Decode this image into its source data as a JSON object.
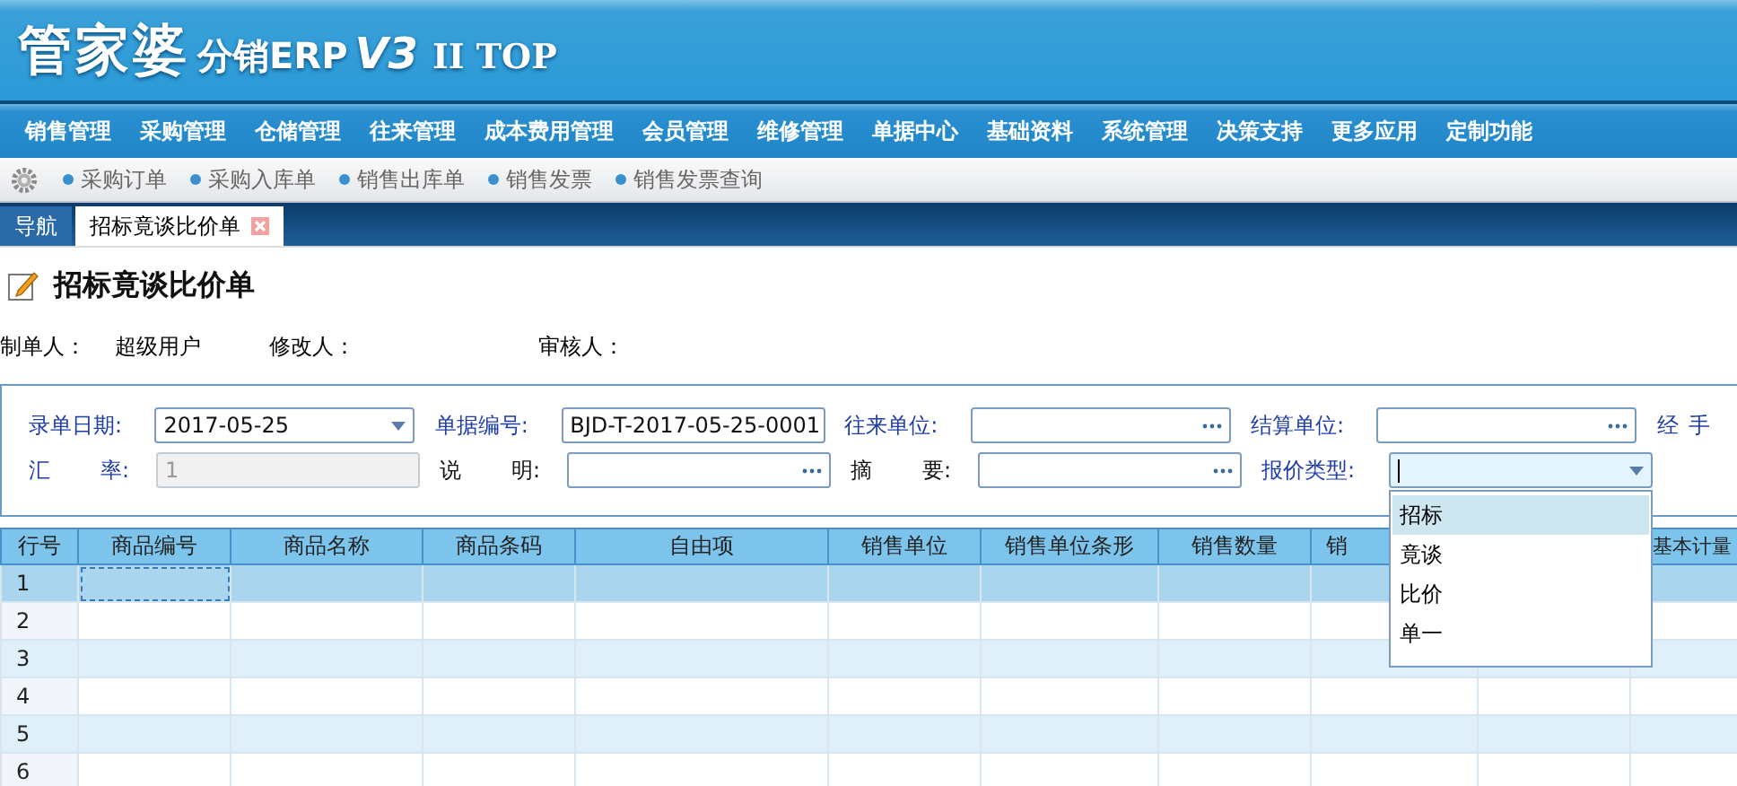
{
  "app": {
    "logo_main": "管家婆",
    "logo_sub": "分销ERP",
    "logo_version": "V3",
    "logo_edition": "II TOP"
  },
  "menu": [
    "销售管理",
    "采购管理",
    "仓储管理",
    "往来管理",
    "成本费用管理",
    "会员管理",
    "维修管理",
    "单据中心",
    "基础资料",
    "系统管理",
    "决策支持",
    "更多应用",
    "定制功能"
  ],
  "shortcuts": [
    "采购订单",
    "采购入库单",
    "销售出库单",
    "销售发票",
    "销售发票查询"
  ],
  "tabs": [
    {
      "label": "导航",
      "selected": false,
      "closable": false
    },
    {
      "label": "招标竟谈比价单",
      "selected": true,
      "closable": true
    }
  ],
  "page_title": "招标竟谈比价单",
  "meta": [
    {
      "label": "制单人：",
      "value": "超级用户"
    },
    {
      "label": "修改人："
    },
    {
      "label": "审核人："
    }
  ],
  "form_rows": [
    [
      {
        "label": "录单日期:",
        "required": true,
        "kind": "date",
        "value": "2017-05-25"
      },
      {
        "label": "单据编号:",
        "required": true,
        "kind": "text",
        "value": "BJD-T-2017-05-25-0001"
      },
      {
        "label": "往来单位:",
        "required": true,
        "kind": "lookup"
      },
      {
        "label": "结算单位:",
        "required": true,
        "kind": "lookup"
      },
      {
        "label": "经 手",
        "required": true,
        "kind": "label"
      }
    ],
    [
      {
        "label": "汇 率:",
        "required": true,
        "kind": "text",
        "value": "1",
        "disabled": true
      },
      {
        "label": "说 明:",
        "required": false,
        "kind": "lookup"
      },
      {
        "label": "摘 要:",
        "required": false,
        "kind": "lookup"
      },
      {
        "label": "报价类型:",
        "required": true,
        "kind": "combo",
        "focused": true,
        "expanded": true,
        "options": [
          {
            "label": "招标",
            "selected": true
          },
          {
            "label": "竟谈",
            "selected": false
          },
          {
            "label": "比价",
            "selected": false
          },
          {
            "label": "单一",
            "selected": false
          }
        ]
      }
    ]
  ],
  "grid": {
    "columns": [
      "行号",
      "商品编号",
      "商品名称",
      "商品条码",
      "自由项",
      "销售单位",
      "销售单位条形",
      "销售数量",
      "销",
      "",
      "基本计量"
    ],
    "rows": [
      {
        "number": "1",
        "selected": true
      },
      {
        "number": "2",
        "selected": false
      },
      {
        "number": "3",
        "selected": false
      },
      {
        "number": "4",
        "selected": false
      },
      {
        "number": "5",
        "selected": false
      },
      {
        "number": "6",
        "selected": false
      }
    ]
  }
}
